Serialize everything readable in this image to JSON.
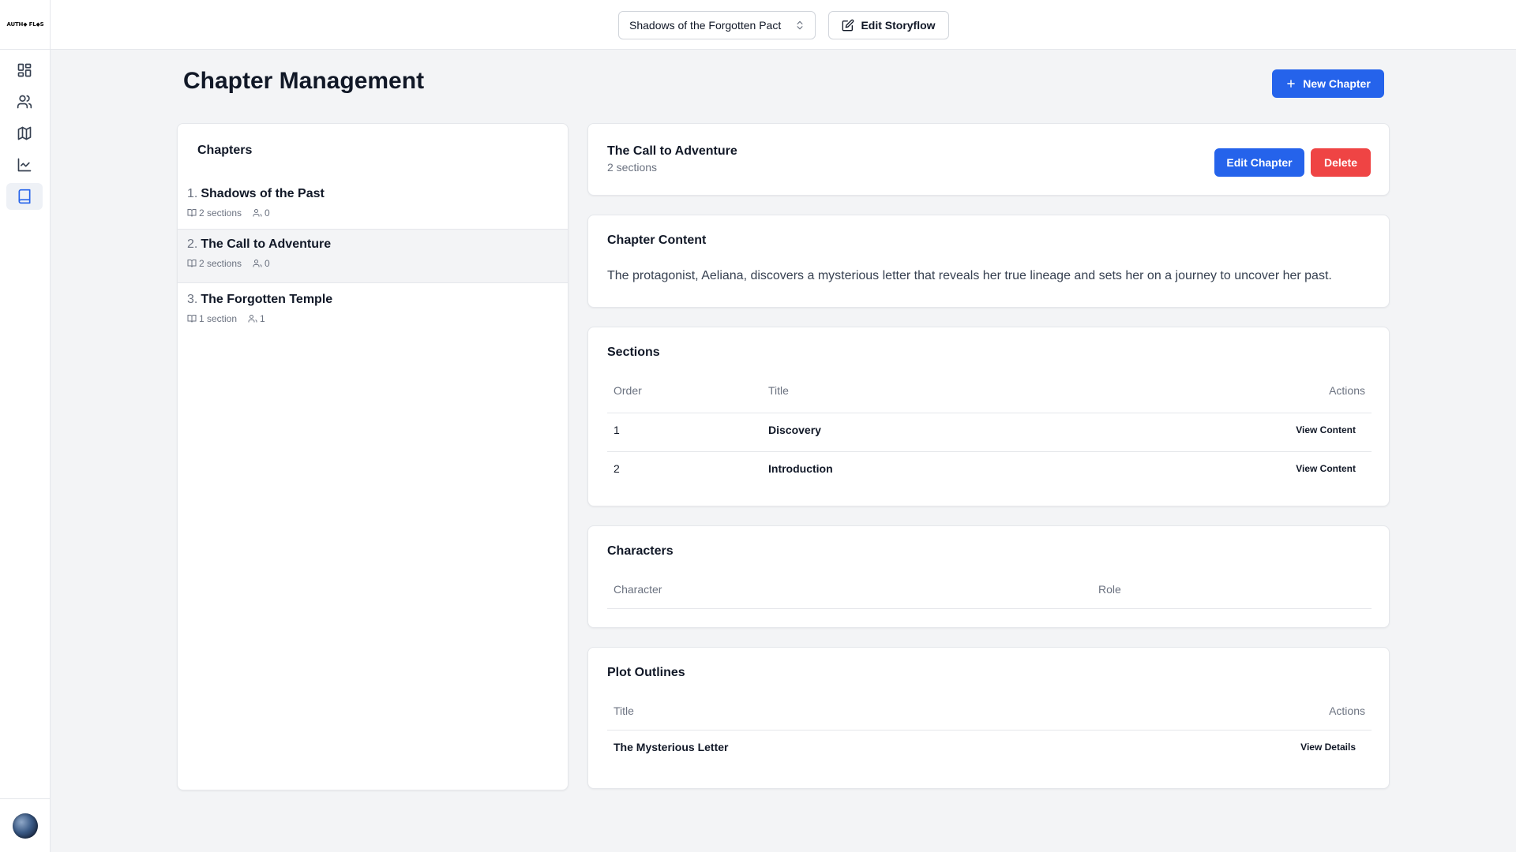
{
  "app": {
    "logo_text": "AUTH◆ FL◆S"
  },
  "sidebar": {
    "items": [
      {
        "name": "dashboard",
        "icon": "dashboard-icon"
      },
      {
        "name": "characters",
        "icon": "users-icon"
      },
      {
        "name": "world",
        "icon": "map-icon"
      },
      {
        "name": "analytics",
        "icon": "chart-line-icon"
      },
      {
        "name": "chapters",
        "icon": "book-icon",
        "active": true
      }
    ]
  },
  "topbar": {
    "story_select_value": "Shadows of the Forgotten Pact",
    "edit_storyflow_label": "Edit Storyflow"
  },
  "page": {
    "title": "Chapter Management",
    "new_chapter_label": "New Chapter"
  },
  "chapters": {
    "title": "Chapters",
    "items": [
      {
        "num": "1.",
        "title": "Shadows of the Past",
        "sections": "2 sections",
        "characters": "0"
      },
      {
        "num": "2.",
        "title": "The Call to Adventure",
        "sections": "2 sections",
        "characters": "0"
      },
      {
        "num": "3.",
        "title": "The Forgotten Temple",
        "sections": "1 section",
        "characters": "1"
      }
    ]
  },
  "detail": {
    "title": "The Call to Adventure",
    "subtitle": "2 sections",
    "edit_label": "Edit Chapter",
    "delete_label": "Delete"
  },
  "content": {
    "title": "Chapter Content",
    "text": "The protagonist, Aeliana, discovers a mysterious letter that reveals her true lineage and sets her on a journey to uncover her past."
  },
  "sections": {
    "title": "Sections",
    "columns": [
      "Order",
      "Title",
      "Actions"
    ],
    "rows": [
      {
        "order": "1",
        "title": "Discovery",
        "action": "View Content"
      },
      {
        "order": "2",
        "title": "Introduction",
        "action": "View Content"
      }
    ]
  },
  "characters": {
    "title": "Characters",
    "columns": [
      "Character",
      "Role"
    ]
  },
  "plots": {
    "title": "Plot Outlines",
    "columns": [
      "Title",
      "Actions"
    ],
    "rows": [
      {
        "title": "The Mysterious Letter",
        "action": "View Details"
      }
    ]
  },
  "colors": {
    "primary": "#2563eb",
    "danger": "#ef4444",
    "background": "#f3f4f6"
  }
}
